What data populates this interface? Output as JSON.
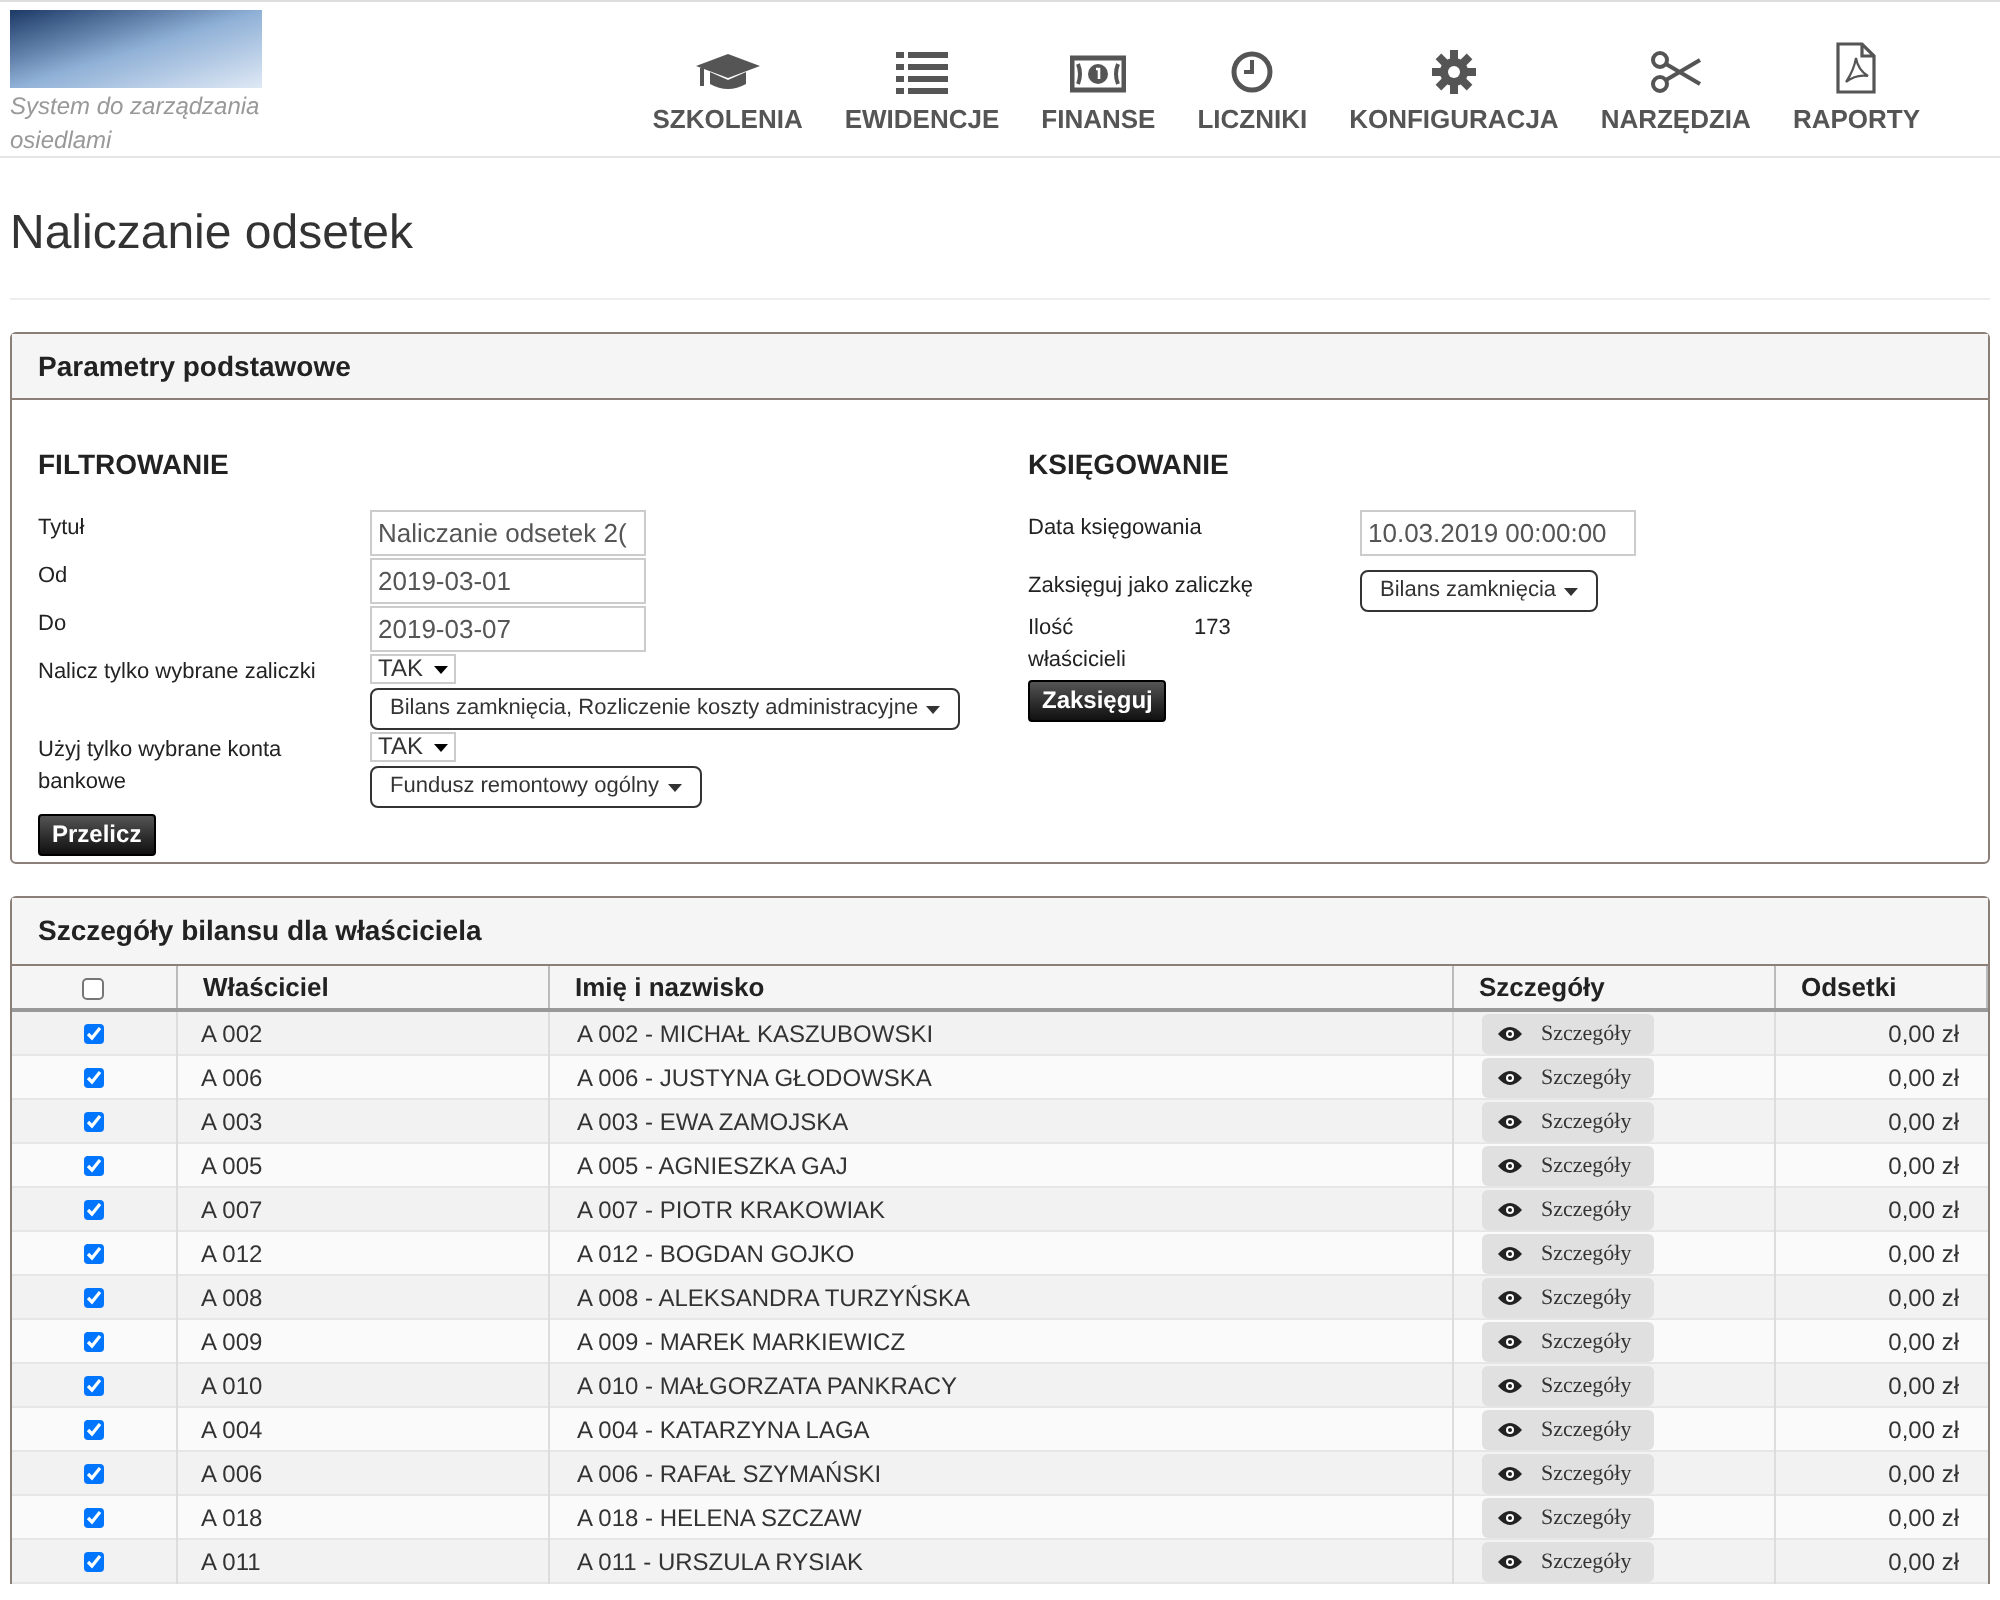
{
  "header": {
    "tagline": "System do zarządzania osiedlami",
    "nav": [
      {
        "label": "SZKOLENIA"
      },
      {
        "label": "EWIDENCJE"
      },
      {
        "label": "FINANSE"
      },
      {
        "label": "LICZNIKI"
      },
      {
        "label": "KONFIGURACJA"
      },
      {
        "label": "NARZĘDZIA"
      },
      {
        "label": "RAPORTY"
      }
    ]
  },
  "page_title": "Naliczanie odsetek",
  "params_panel": {
    "title": "Parametry podstawowe",
    "filter": {
      "heading": "FILTROWANIE",
      "fields": [
        {
          "kind": "input",
          "label": "Tytuł",
          "value": "Naliczanie odsetek 2("
        },
        {
          "kind": "input",
          "label": "Od",
          "value": "2019-03-01"
        },
        {
          "kind": "input",
          "label": "Do",
          "value": "2019-03-07"
        },
        {
          "kind": "select",
          "label": "Nalicz tylko wybrane zaliczki",
          "value": "TAK",
          "dropdown": "Bilans zamknięcia, Rozliczenie koszty administracyjne"
        },
        {
          "kind": "select",
          "label": "Użyj tylko wybrane konta bankowe",
          "value": "TAK",
          "dropdown": "Fundusz remontowy ogólny"
        }
      ],
      "button": "Przelicz"
    },
    "posting": {
      "heading": "KSIĘGOWANIE",
      "date_label": "Data księgowania",
      "date_value": "10.03.2019 00:00:00",
      "as_label": "Zaksięguj jako zaliczkę",
      "as_dropdown": "Bilans zamknięcia",
      "count_label": "Ilość właścicieli",
      "count_value": "173",
      "button": "Zaksięguj"
    }
  },
  "details_panel": {
    "title": "Szczegóły bilansu dla właściciela",
    "table": {
      "select_all_checked": false,
      "columns": [
        "Właściciel",
        "Imię i nazwisko",
        "Szczegóły",
        "Odsetki"
      ],
      "rows": [
        {
          "checked": true,
          "owner": "A 002",
          "name": "A 002 - MICHAŁ KASZUBOWSKI",
          "details": "Szczegóły",
          "interest": "0,00 zł"
        },
        {
          "checked": true,
          "owner": "A 006",
          "name": "A 006 - JUSTYNA GŁODOWSKA",
          "details": "Szczegóły",
          "interest": "0,00 zł"
        },
        {
          "checked": true,
          "owner": "A 003",
          "name": "A 003 - EWA ZAMOJSKA",
          "details": "Szczegóły",
          "interest": "0,00 zł"
        },
        {
          "checked": true,
          "owner": "A 005",
          "name": "A 005 - AGNIESZKA GAJ",
          "details": "Szczegóły",
          "interest": "0,00 zł"
        },
        {
          "checked": true,
          "owner": "A 007",
          "name": "A 007 - PIOTR KRAKOWIAK",
          "details": "Szczegóły",
          "interest": "0,00 zł"
        },
        {
          "checked": true,
          "owner": "A 012",
          "name": "A 012 - BOGDAN GOJKO",
          "details": "Szczegóły",
          "interest": "0,00 zł"
        },
        {
          "checked": true,
          "owner": "A 008",
          "name": "A 008 - ALEKSANDRA TURZYŃSKA",
          "details": "Szczegóły",
          "interest": "0,00 zł"
        },
        {
          "checked": true,
          "owner": "A 009",
          "name": "A 009 - MAREK MARKIEWICZ",
          "details": "Szczegóły",
          "interest": "0,00 zł"
        },
        {
          "checked": true,
          "owner": "A 010",
          "name": "A 010 - MAŁGORZATA PANKRACY",
          "details": "Szczegóły",
          "interest": "0,00 zł"
        },
        {
          "checked": true,
          "owner": "A 004",
          "name": "A 004 - KATARZYNA LAGA",
          "details": "Szczegóły",
          "interest": "0,00 zł"
        },
        {
          "checked": true,
          "owner": "A 006",
          "name": "A 006 - RAFAŁ SZYMAŃSKI",
          "details": "Szczegóły",
          "interest": "0,00 zł"
        },
        {
          "checked": true,
          "owner": "A 018",
          "name": "A 018 - HELENA SZCZAW",
          "details": "Szczegóły",
          "interest": "0,00 zł"
        },
        {
          "checked": true,
          "owner": "A 011",
          "name": "A 011 - URSZULA RYSIAK",
          "details": "Szczegóły",
          "interest": "0,00 zł"
        }
      ]
    }
  }
}
